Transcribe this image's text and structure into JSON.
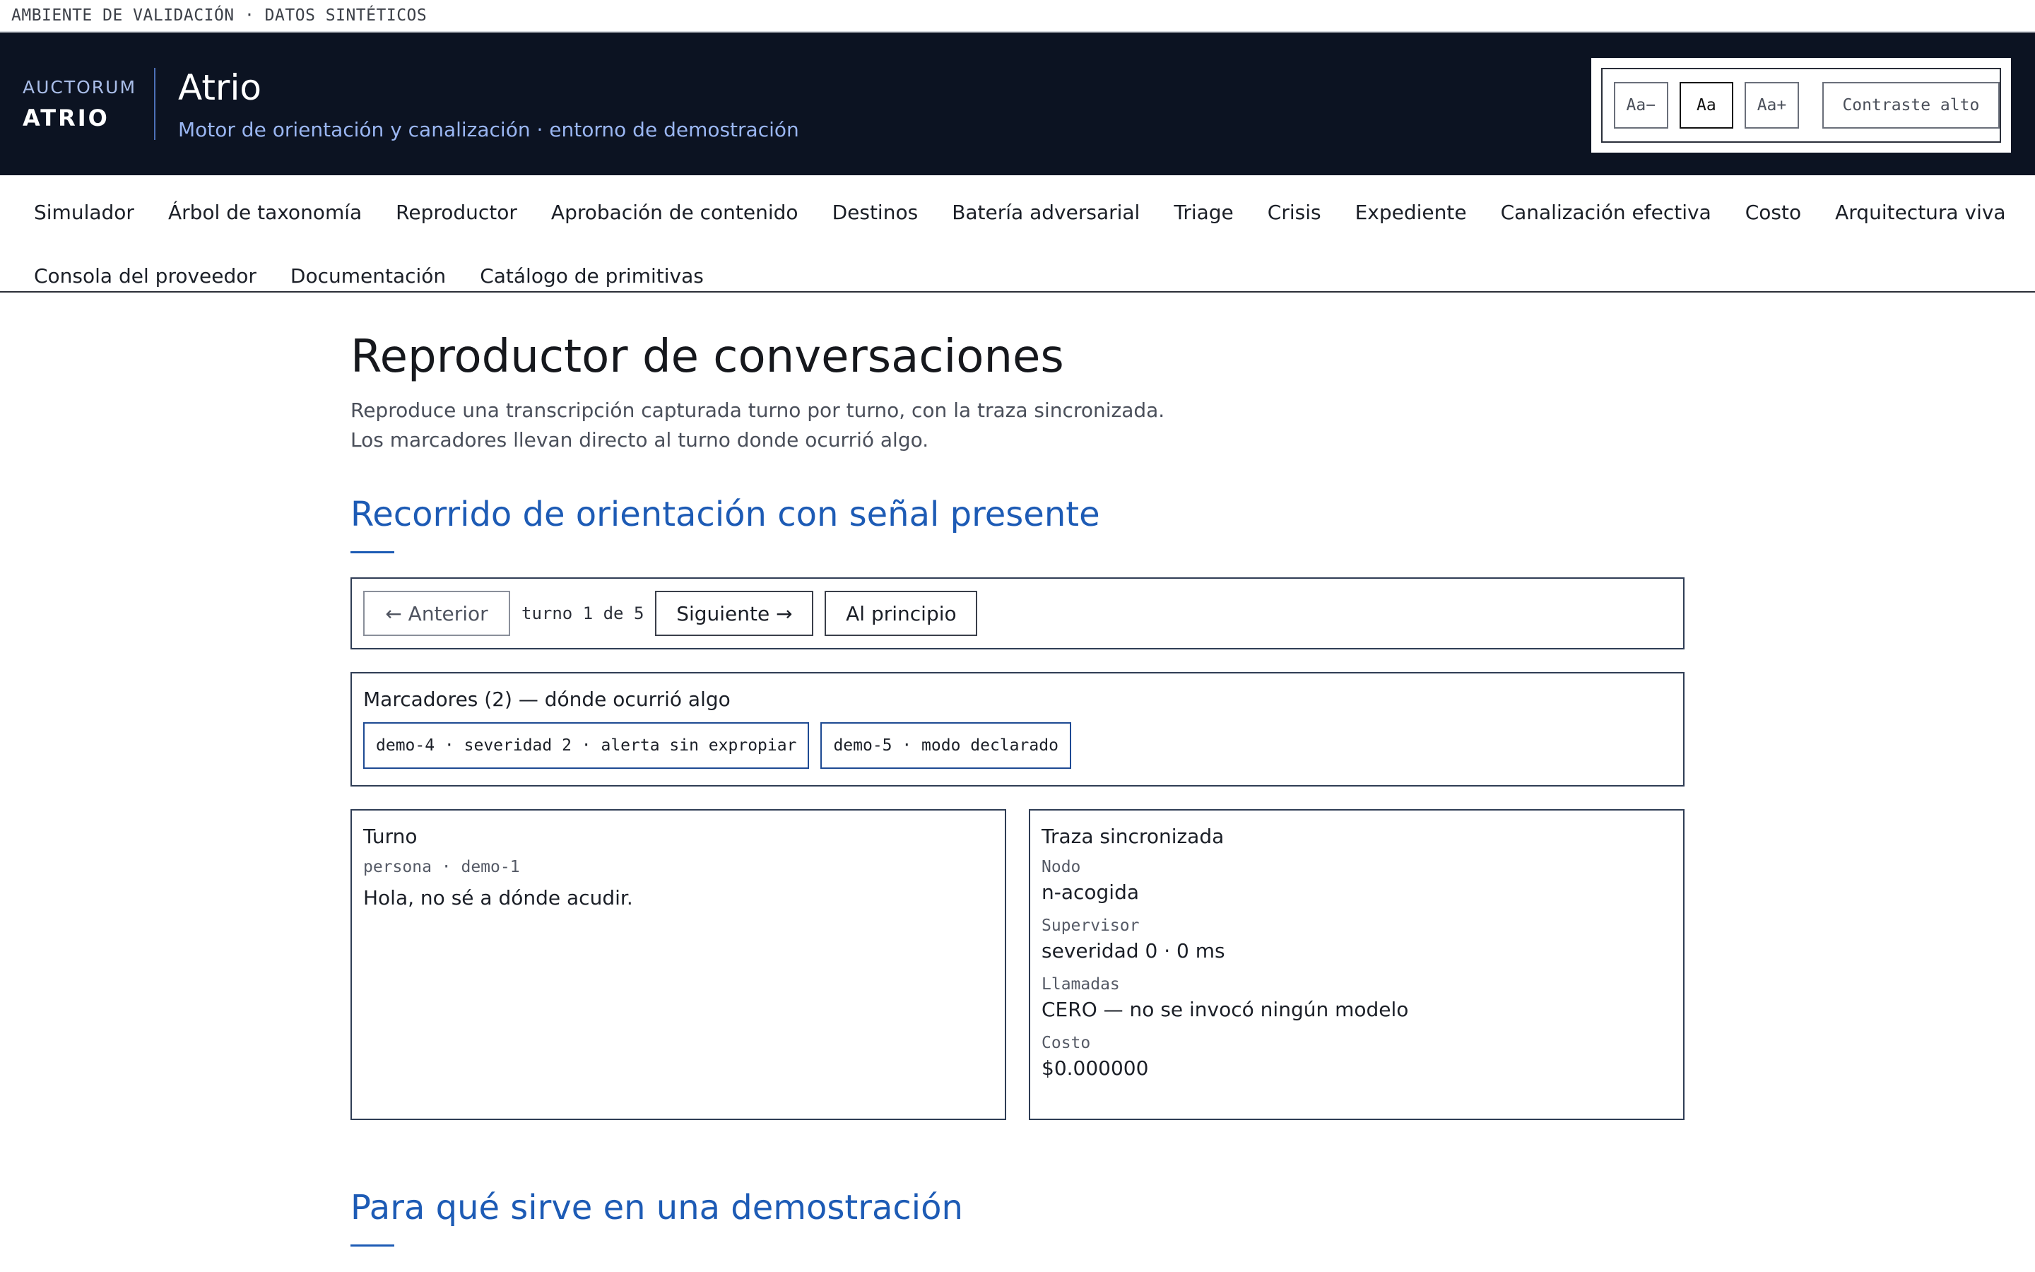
{
  "env_banner": "AMBIENTE DE VALIDACIÓN · DATOS SINTÉTICOS",
  "brand": {
    "small": "AUCTORUM",
    "big": "ATRIO"
  },
  "app": {
    "title": "Atrio",
    "subtitle": "Motor de orientación y canalización · entorno de demostración"
  },
  "a11y": {
    "decrease": "Aa−",
    "normal": "Aa",
    "increase": "Aa+",
    "contrast": "Contraste alto"
  },
  "nav": {
    "row1": [
      "Simulador",
      "Árbol de taxonomía",
      "Reproductor",
      "Aprobación de contenido",
      "Destinos",
      "Batería adversarial",
      "Triage",
      "Crisis",
      "Expediente",
      "Canalización efectiva",
      "Costo",
      "Arquitectura viva"
    ],
    "row2": [
      "Consola del proveedor",
      "Documentación",
      "Catálogo de primitivas"
    ]
  },
  "page": {
    "title": "Reproductor de conversaciones",
    "description": "Reproduce una transcripción capturada turno por turno, con la traza sincronizada. Los marcadores llevan directo al turno donde ocurrió algo."
  },
  "section1": {
    "title": "Recorrido de orientación con señal presente"
  },
  "controls": {
    "prev": "← Anterior",
    "counter": "turno 1 de 5",
    "next": "Siguiente →",
    "start": "Al principio"
  },
  "markers": {
    "title": "Marcadores (2) — dónde ocurrió algo",
    "items": [
      "demo-4 · severidad 2 · alerta sin expropiar",
      "demo-5 · modo declarado"
    ]
  },
  "turn": {
    "title": "Turno",
    "meta": "persona · demo-1",
    "text": "Hola, no sé a dónde acudir."
  },
  "trace": {
    "title": "Traza sincronizada",
    "node_label": "Nodo",
    "node_value": "n-acogida",
    "supervisor_label": "Supervisor",
    "supervisor_value": "severidad 0 · 0 ms",
    "calls_label": "Llamadas",
    "calls_value": "CERO — no se invocó ningún modelo",
    "cost_label": "Costo",
    "cost_value": "$0.000000"
  },
  "section2": {
    "title": "Para qué sirve en una demostración"
  }
}
